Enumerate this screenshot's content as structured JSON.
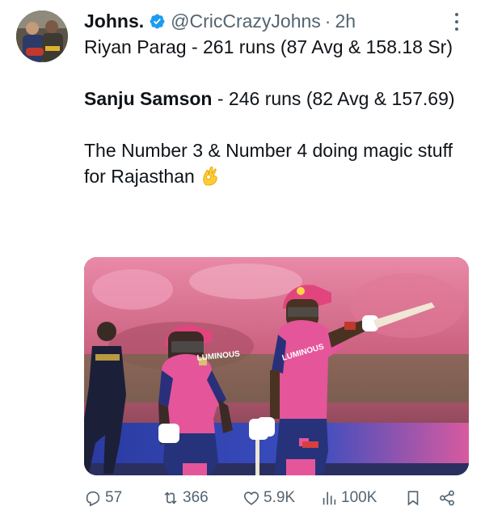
{
  "author": {
    "name": "Johns.",
    "handle": "@CricCrazyJohns",
    "separator": "·",
    "time": "2h"
  },
  "tweet": {
    "line1": "Riyan Parag - 261 runs (87 Avg & 158.18 Sr)",
    "line2_bold": "Sanju Samson",
    "line2_rest": " - 246 runs (82 Avg & 157.69)",
    "line3": "The Number 3 & Number 4 doing magic stuff for Rajasthan",
    "emoji_icon": "ok-hand-emoji"
  },
  "media": {
    "jersey_sponsor_left": "LUMINOUS",
    "jersey_sponsor_right": "LUMINOUS"
  },
  "actions": {
    "replies": "57",
    "retweets": "366",
    "likes": "5.9K",
    "views": "100K"
  },
  "colors": {
    "text": "#0f1419",
    "secondary": "#536471",
    "verified": "#1d9bf0"
  }
}
